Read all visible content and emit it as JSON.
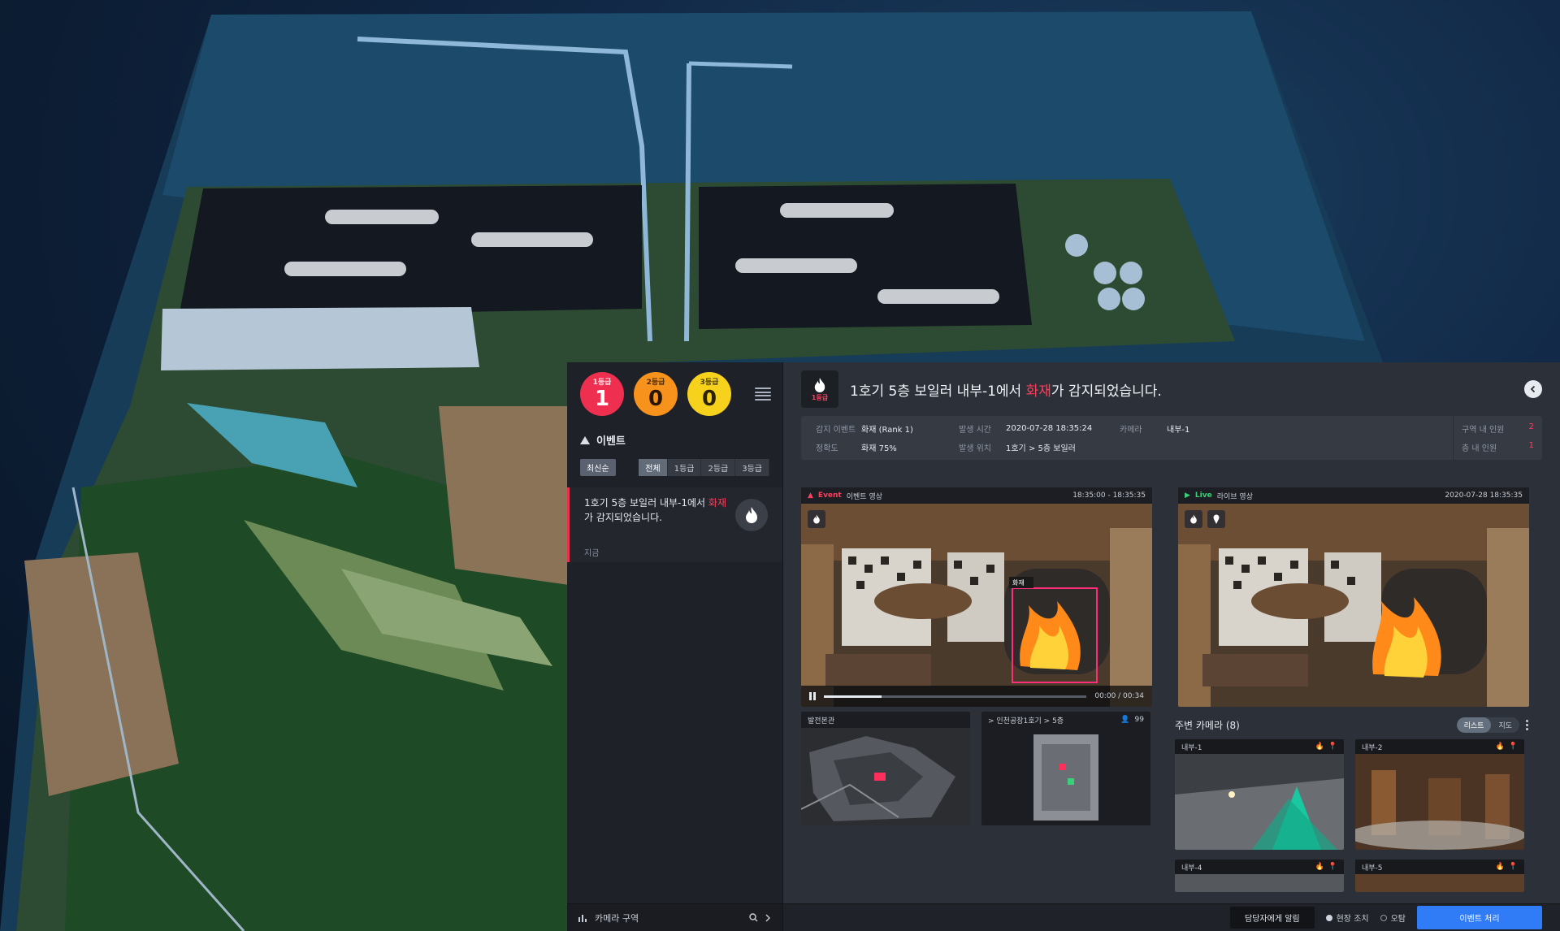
{
  "counters": [
    {
      "level": "1등급",
      "count": "1"
    },
    {
      "level": "2등급",
      "count": "0"
    },
    {
      "level": "3등급",
      "count": "0"
    }
  ],
  "sidebar": {
    "events_title": "이벤트",
    "filter_main": "최신순",
    "filter_tabs": [
      "전체",
      "1등급",
      "2등급",
      "3등급"
    ],
    "event": {
      "text_before": "1호기 5층 보일러 내부-1에서 ",
      "highlight": "화재",
      "text_after": "가 감지되었습니다.",
      "time": "지금"
    },
    "bottom_label": "카메라 구역"
  },
  "header": {
    "level_label": "1등급",
    "title_before": "1호기 5층 보일러 내부-1에서 ",
    "title_highlight": "화재",
    "title_after": "가 감지되었습니다."
  },
  "info": {
    "detect_event_key": "감지 이벤트",
    "detect_event_val": "화재 (Rank 1)",
    "accuracy_key": "정확도",
    "accuracy_val": "화재 75%",
    "occur_time_key": "발생 시간",
    "occur_time_val": "2020-07-28 18:35:24",
    "occur_loc_key": "발생 위치",
    "occur_loc_val": "1호기 > 5층 보일러",
    "camera_key": "카메라",
    "camera_val": "내부-1",
    "zone_people_key": "구역 내 인원",
    "zone_people_val": "2",
    "floor_people_key": "층 내 인원",
    "floor_people_val": "1"
  },
  "video_left": {
    "status": "Event",
    "label": "이벤트 영상",
    "time_range": "18:35:00 - 18:35:35",
    "box_label": "화재",
    "timecode": "00:00 / 00:34",
    "progress": 0.22
  },
  "video_right": {
    "status": "Live",
    "label": "라이브 영상",
    "time": "2020-07-28 18:35:35"
  },
  "minimap_left": {
    "title": "발전본관"
  },
  "minimap_right": {
    "title": "> 인천공장1호기 > 5층",
    "people_count": "99"
  },
  "nearby": {
    "title": "주변 카메라 (8)",
    "seg_on": "리스트",
    "seg_off": "지도"
  },
  "cams": [
    {
      "name": "내부-1"
    },
    {
      "name": "내부-2"
    },
    {
      "name": "내부-4"
    },
    {
      "name": "내부-5"
    }
  ],
  "footer": {
    "report_btn": "담당자에게 알림",
    "radio_on": "현장 조치",
    "radio_off": "오탐",
    "submit_btn": "이벤트 처리"
  },
  "colors": {
    "accent_red": "#ee2f4f",
    "accent_orange": "#f7931c",
    "accent_yellow": "#f6d21d",
    "accent_blue": "#2f7cf6"
  }
}
